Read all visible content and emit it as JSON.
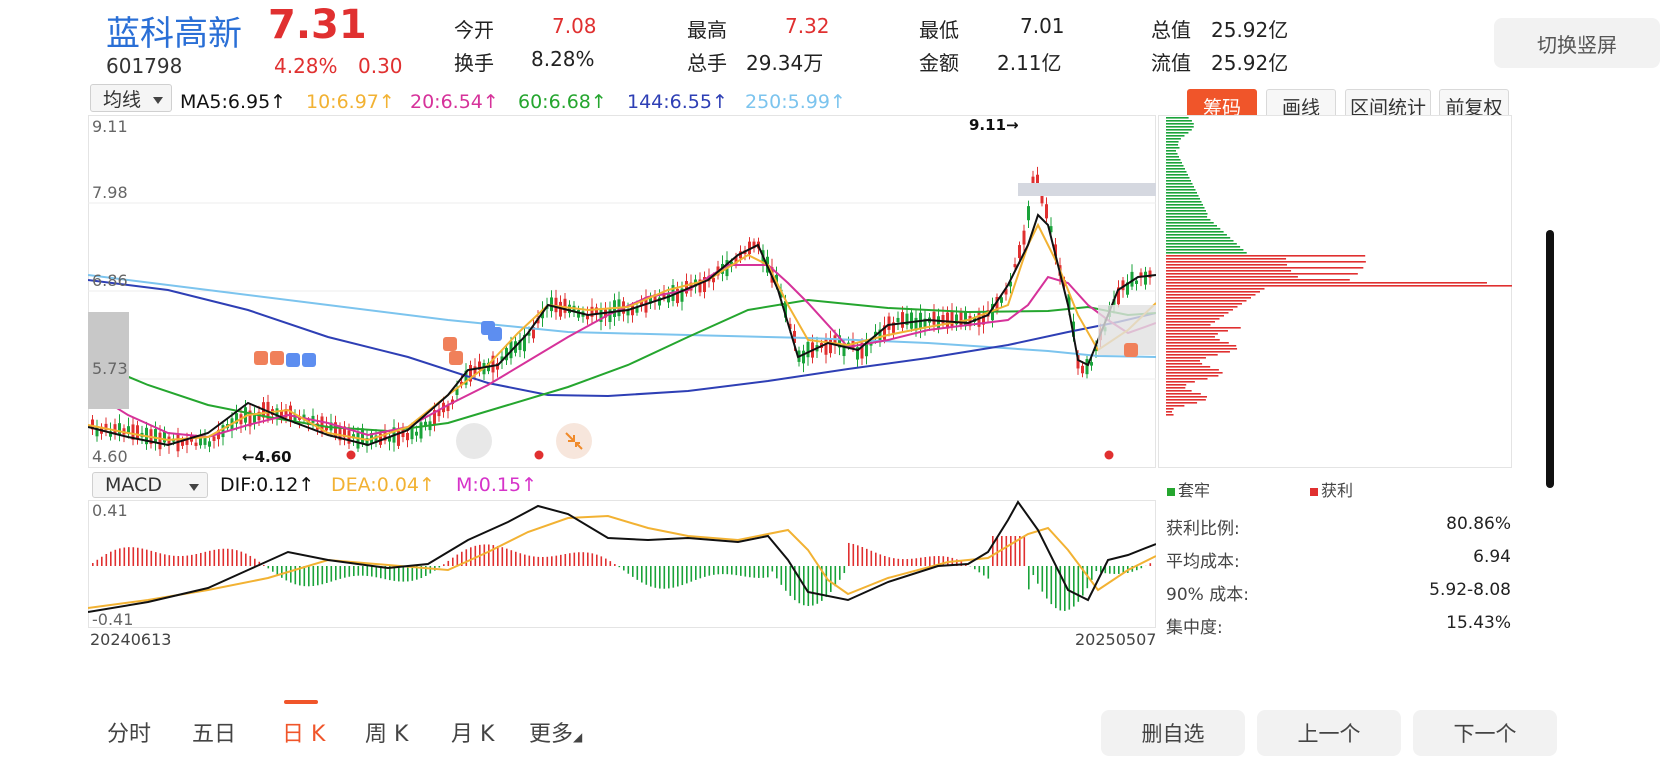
{
  "stock": {
    "name": "蓝科高新",
    "code": "601798",
    "price": "7.31",
    "change_pct": "4.28%",
    "change_amt": "0.30"
  },
  "quote": {
    "open_label": "今开",
    "open": "7.08",
    "turnover_label": "换手",
    "turnover": "8.28%",
    "high_label": "最高",
    "high": "7.32",
    "volume_label": "总手",
    "volume": "29.34万",
    "low_label": "最低",
    "low": "7.01",
    "amount_label": "金额",
    "amount": "2.11亿",
    "mktcap_label": "总值",
    "mktcap": "25.92亿",
    "float_label": "流值",
    "float": "25.92亿"
  },
  "switch_button": "切换竖屏",
  "indicator_select": "均线",
  "ma": {
    "ma5": "MA5:6.95↑",
    "ma10": "10:6.97↑",
    "ma20": "20:6.54↑",
    "ma60": "60:6.68↑",
    "ma144": "144:6.55↑",
    "ma250": "250:5.99↑"
  },
  "toolbar": {
    "chips": "筹码",
    "draw": "画线",
    "range_stats": "区间统计",
    "adjust": "前复权"
  },
  "price_axis": [
    "9.11",
    "7.98",
    "6.86",
    "5.73",
    "4.60"
  ],
  "kline_annotations": {
    "high_mark": "9.11→",
    "low_mark": "←4.60"
  },
  "macd": {
    "select": "MACD",
    "dif": "DIF:0.12↑",
    "dea": "DEA:0.04↑",
    "m": "M:0.15↑",
    "axis_top": "0.41",
    "axis_bottom": "-0.41"
  },
  "dates": {
    "start": "20240613",
    "end": "20250507"
  },
  "chips_panel": {
    "legend_trapped": "套牢",
    "legend_profit": "获利",
    "profit_ratio_label": "获利比例:",
    "profit_ratio": "80.86%",
    "avg_cost_label": "平均成本:",
    "avg_cost": "6.94",
    "cost90_label": "90% 成本:",
    "cost90": "5.92-8.08",
    "concentration_label": "集中度:",
    "concentration": "15.43%"
  },
  "bottom_tabs": [
    "分时",
    "五日",
    "日 K",
    "周 K",
    "月 K",
    "更多"
  ],
  "bottom_buttons": {
    "remove_watch": "删自选",
    "prev": "上一个",
    "next": "下一个"
  },
  "colors": {
    "up": "#e03030",
    "down": "#1aa33a",
    "accent": "#f0552a",
    "ma5": "#111111",
    "ma10": "#f2b233",
    "ma20": "#d6329a",
    "ma60": "#25a62f",
    "ma144": "#2e3fb5",
    "ma250": "#7cc4ee"
  }
}
